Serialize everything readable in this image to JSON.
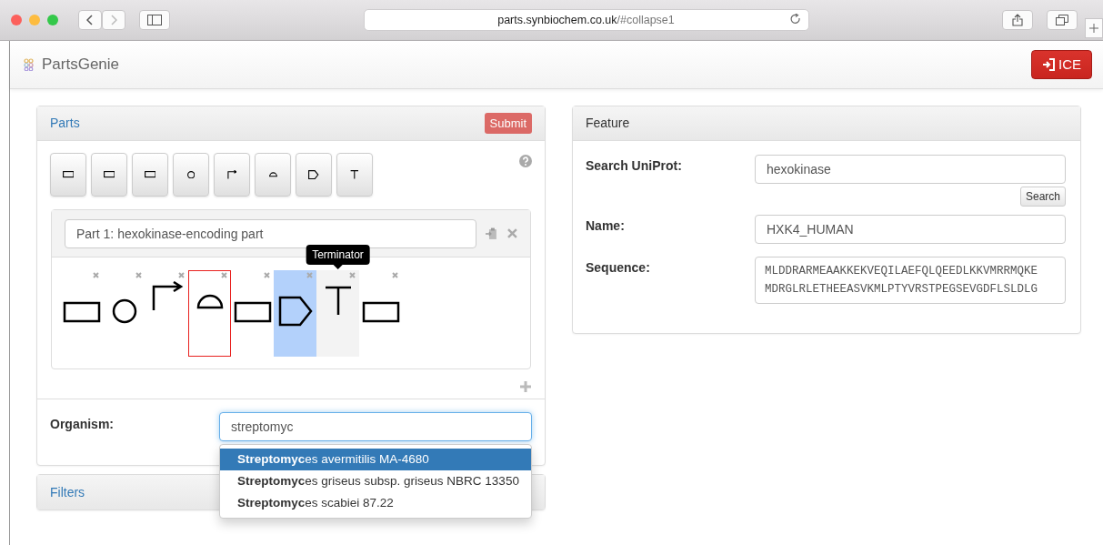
{
  "browser": {
    "url_host": "parts.synbiochem.co.uk",
    "url_path": "/#collapse1"
  },
  "navbar": {
    "brand": "PartsGenie",
    "button": "ICE"
  },
  "parts_panel": {
    "title": "Parts",
    "submit": "Submit",
    "palette": [
      {
        "kind": "rect"
      },
      {
        "kind": "rect"
      },
      {
        "kind": "rect"
      },
      {
        "kind": "circle"
      },
      {
        "kind": "promoter"
      },
      {
        "kind": "rbs"
      },
      {
        "kind": "cds"
      },
      {
        "kind": "terminator"
      }
    ],
    "part": {
      "name": "Part 1: hexokinase-encoding part",
      "features": [
        {
          "kind": "rect",
          "selected": false,
          "focused": false,
          "hovered": false
        },
        {
          "kind": "circle",
          "selected": false,
          "focused": false,
          "hovered": false
        },
        {
          "kind": "promoter",
          "selected": false,
          "focused": false,
          "hovered": false
        },
        {
          "kind": "rbs",
          "selected": false,
          "focused": true,
          "hovered": false
        },
        {
          "kind": "rect",
          "selected": false,
          "focused": false,
          "hovered": false
        },
        {
          "kind": "cds",
          "selected": true,
          "focused": false,
          "hovered": false
        },
        {
          "kind": "terminator",
          "selected": false,
          "focused": false,
          "hovered": true,
          "tooltip": "Terminator"
        },
        {
          "kind": "rect",
          "selected": false,
          "focused": false,
          "hovered": false
        }
      ]
    },
    "organism": {
      "label": "Organism:",
      "value": "streptomyc",
      "suggestions": [
        {
          "text": "**Streptomyc**es avermitilis MA-4680",
          "selected": true
        },
        {
          "text": "**Streptomyc**es griseus subsp. griseus NBRC 13350",
          "selected": false
        },
        {
          "text": "**Streptomyc**es scabiei 87.22",
          "selected": false
        }
      ]
    }
  },
  "filters_panel": {
    "title": "Filters"
  },
  "feature_panel": {
    "title": "Feature",
    "search": {
      "label": "Search UniProt:",
      "value": "hexokinase",
      "button": "Search"
    },
    "name": {
      "label": "Name:",
      "value": "HXK4_HUMAN"
    },
    "sequence": {
      "label": "Sequence:",
      "value": "MLDDRARMEAAKKEKVEQILAEFQLQEEDLKKVMRRMQKEMDRGLRLETHEEASVKMLPTYVRSTPEGSEVGDFLSLDLG"
    }
  }
}
